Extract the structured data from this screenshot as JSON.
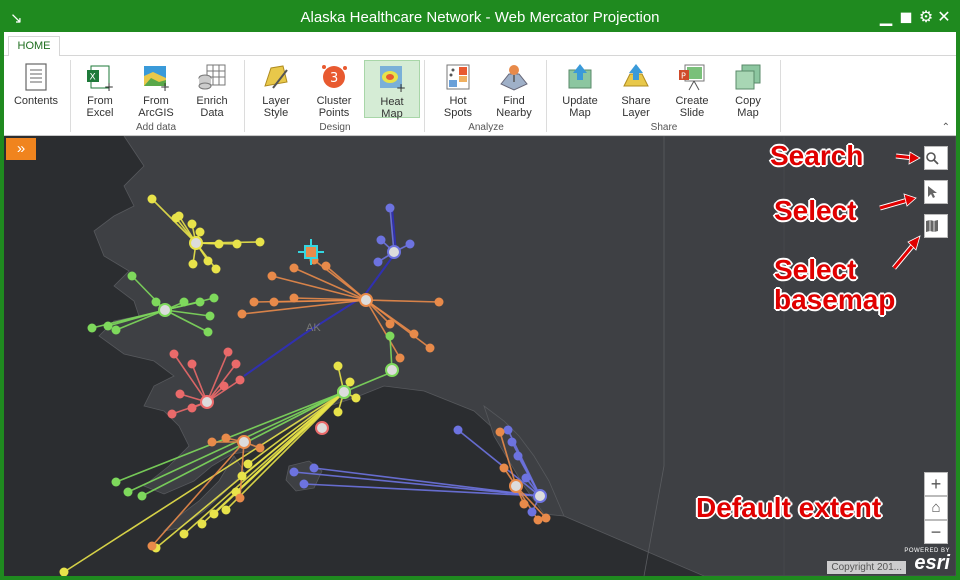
{
  "window": {
    "title": "Alaska Healthcare Network - Web Mercator Projection",
    "minimize_glyph": "▁",
    "restore_glyph": "◼",
    "settings_glyph": "⚙",
    "close_glyph": "✕",
    "app_glyph": "↘"
  },
  "tabs": [
    {
      "label": "HOME"
    }
  ],
  "ribbon": {
    "contents": {
      "label": "Contents"
    },
    "from_excel": {
      "label": "From\nExcel"
    },
    "from_arcgis": {
      "label": "From\nArcGIS"
    },
    "enrich_data": {
      "label": "Enrich\nData"
    },
    "group_add_data": "Add data",
    "layer_style": {
      "label": "Layer\nStyle"
    },
    "cluster_points": {
      "label": "Cluster\nPoints",
      "badge": "3"
    },
    "heat_map": {
      "label": "Heat\nMap"
    },
    "group_design": "Design",
    "hot_spots": {
      "label": "Hot\nSpots"
    },
    "find_nearby": {
      "label": "Find\nNearby"
    },
    "group_analyze": "Analyze",
    "update_map": {
      "label": "Update\nMap"
    },
    "share_layer": {
      "label": "Share\nLayer"
    },
    "create_slide": {
      "label": "Create\nSlide"
    },
    "copy_map": {
      "label": "Copy\nMap"
    },
    "group_share": "Share",
    "collapse_glyph": "⌃"
  },
  "map": {
    "expand_glyph": "»",
    "state_label": "AK",
    "zoom_in": "+",
    "home_glyph": "⌂",
    "zoom_out": "−",
    "copyright": "Copyright 201...",
    "esri_powered": "POWERED BY",
    "esri_brand": "esri",
    "colors": {
      "yellow": "#e8e34a",
      "blue": "#6d73e0",
      "orange": "#e88a4a",
      "green": "#7ed95c",
      "red": "#ea6a6a",
      "land": "#3e4044",
      "water": "#2b2d30"
    }
  },
  "annotations": {
    "search": "Search",
    "select": "Select",
    "select_basemap_line1": "Select",
    "select_basemap_line2": "basemap",
    "default_extent": "Default extent"
  }
}
